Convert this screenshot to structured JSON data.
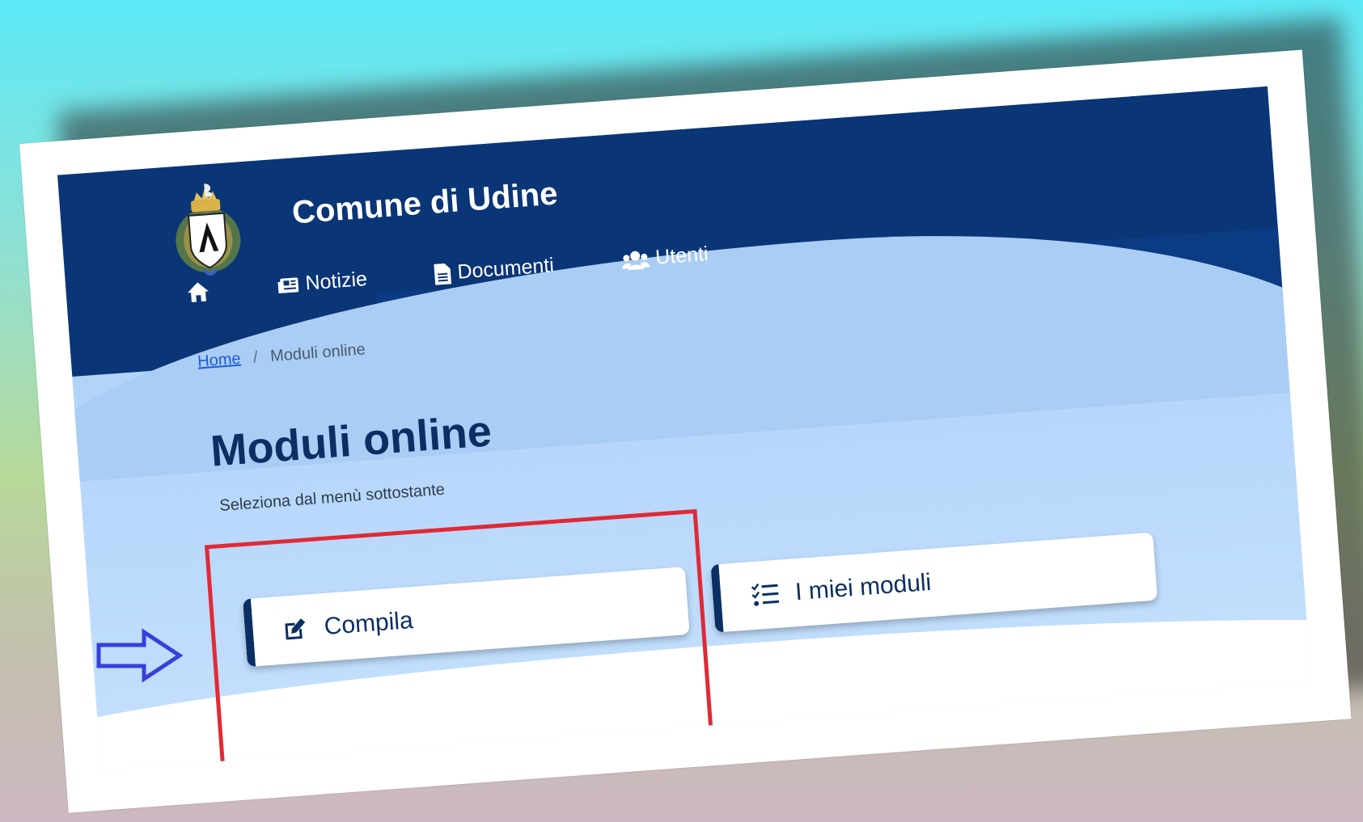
{
  "header": {
    "site_title": "Comune di Udine",
    "crest_icon": "municipal-crest-icon"
  },
  "nav": {
    "items": [
      {
        "label": "",
        "icon": "home-icon"
      },
      {
        "label": "Notizie",
        "icon": "newspaper-icon"
      },
      {
        "label": "Documenti",
        "icon": "document-icon"
      },
      {
        "label": "Utenti",
        "icon": "users-icon"
      }
    ]
  },
  "breadcrumb": {
    "home": "Home",
    "separator": "/",
    "current": "Moduli online"
  },
  "main": {
    "title": "Moduli online",
    "subtitle": "Seleziona dal menù sottostante",
    "actions": [
      {
        "label": "Compila",
        "icon": "edit-icon"
      },
      {
        "label": "I miei moduli",
        "icon": "checklist-icon"
      }
    ]
  },
  "annotations": {
    "highlight_color": "#e02a36",
    "arrow_color": "#3a3fd9"
  },
  "colors": {
    "header_blue": "#0a3577",
    "title_blue": "#0b2f63",
    "link_blue": "#1f5bd6"
  }
}
